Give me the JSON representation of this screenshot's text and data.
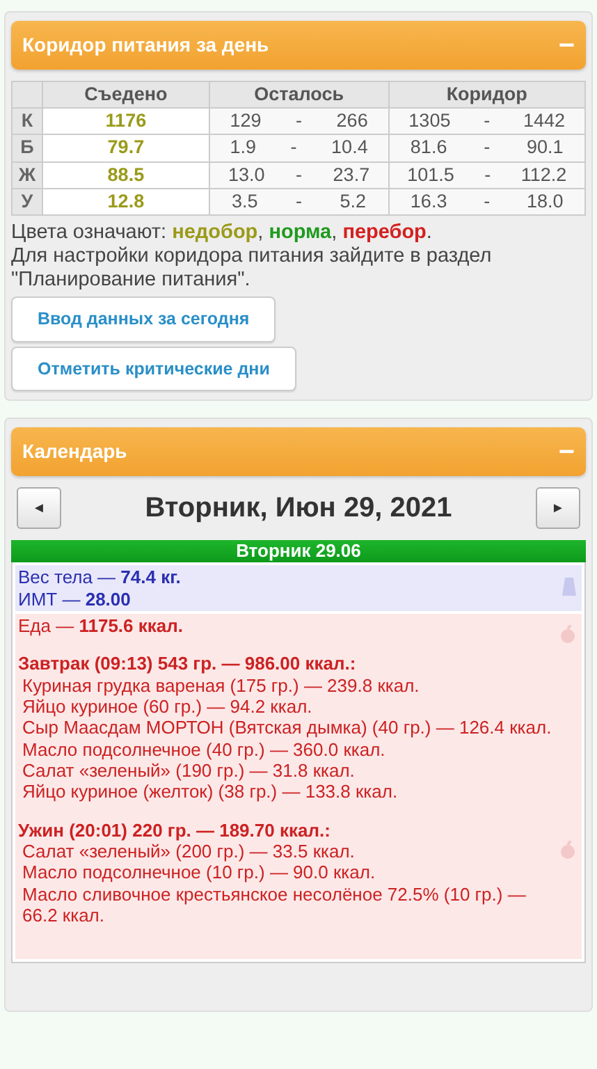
{
  "corridor_panel": {
    "title": "Коридор питания за день",
    "collapse": "−",
    "columns": [
      "Съедено",
      "Осталось",
      "Коридор"
    ],
    "rows": [
      {
        "label": "К",
        "eaten": "1176",
        "color": "#9a9a1a",
        "left_min": "129",
        "left_max": "266",
        "corr_min": "1305",
        "corr_max": "1442"
      },
      {
        "label": "Б",
        "eaten": "79.7",
        "color": "#9a9a1a",
        "left_min": "1.9",
        "left_max": "10.4",
        "corr_min": "81.6",
        "corr_max": "90.1"
      },
      {
        "label": "Ж",
        "eaten": "88.5",
        "color": "#9a9a1a",
        "left_min": "13.0",
        "left_max": "23.7",
        "corr_min": "101.5",
        "corr_max": "112.2"
      },
      {
        "label": "У",
        "eaten": "12.8",
        "color": "#9a9a1a",
        "left_min": "3.5",
        "left_max": "5.2",
        "corr_min": "16.3",
        "corr_max": "18.0"
      }
    ],
    "range_separator": "-",
    "legend": [
      {
        "text": "Цвета означают: "
      },
      {
        "text": "недобор",
        "color": "#9a9a1a"
      },
      {
        "text": ", "
      },
      {
        "text": "норма",
        "color": "#1f9a1f"
      },
      {
        "text": ", "
      },
      {
        "text": "перебор",
        "color": "#d42020"
      },
      {
        "text": "."
      }
    ],
    "note": "Для настройки коридора питания зайдите в раздел \"Планирование питания\".",
    "buttons": [
      "Ввод данных за сегодня",
      "Отметить критические дни"
    ]
  },
  "calendar_panel": {
    "title": "Календарь",
    "collapse": "−",
    "prev": "◄",
    "next": "►",
    "date": "Вторник, Июн 29, 2021",
    "day_header": "Вторник 29.06",
    "entries": [
      {
        "kind": "weight",
        "lines": [
          "Вес тела — **74.4 кг.**",
          "ИМТ — **28.00**"
        ]
      },
      {
        "kind": "food",
        "lines": [
          "Еда — **1175.6 ккал.**"
        ],
        "meals": [
          {
            "title": "Завтрак (09:13) 543 гр. — 986.00 ккал.:",
            "items": [
              "Куриная грудка вареная (175 гр.) — 239.8 ккал.",
              "Яйцо куриное (60 гр.) — 94.2 ккал.",
              "Сыр Маасдам МОРТОН (Вятская дымка) (40 гр.) — 126.4 ккал.",
              "Масло подсолнечное (40 гр.) — 360.0 ккал.",
              "Салат «зеленый» (190 гр.) — 31.8 ккал.",
              "Яйцо куриное (желток) (38 гр.) — 133.8 ккал."
            ]
          },
          {
            "title": "Ужин (20:01) 220 гр. — 189.70 ккал.:",
            "items": [
              "Салат «зеленый» (200 гр.) — 33.5 ккал.",
              "Масло подсолнечное (10 гр.) — 90.0 ккал.",
              "Масло сливочное крестьянское несолёное 72.5% (10 гр.) — 66.2 ккал."
            ]
          }
        ]
      }
    ]
  }
}
